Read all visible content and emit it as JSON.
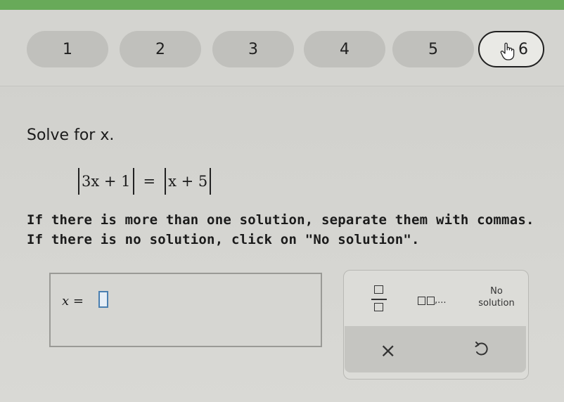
{
  "progress": {
    "steps": [
      "1",
      "2",
      "3",
      "4",
      "5",
      "6"
    ],
    "current_step": "6"
  },
  "question": {
    "prompt": "Solve for x.",
    "equation": {
      "lhs": "3x + 1",
      "equals": "=",
      "rhs": "x + 5"
    },
    "instruction_1": "If there is more than one solution, separate them with commas.",
    "instruction_2": "If there is no solution, click on \"No solution\"."
  },
  "answer": {
    "variable_label": "x =",
    "value": ""
  },
  "tools": {
    "list_label": ",...",
    "no_solution_line1": "No",
    "no_solution_line2": "solution",
    "clear_symbol": "×"
  },
  "colors": {
    "top_bar": "#68aa59",
    "input_border": "#4a7fb0"
  }
}
